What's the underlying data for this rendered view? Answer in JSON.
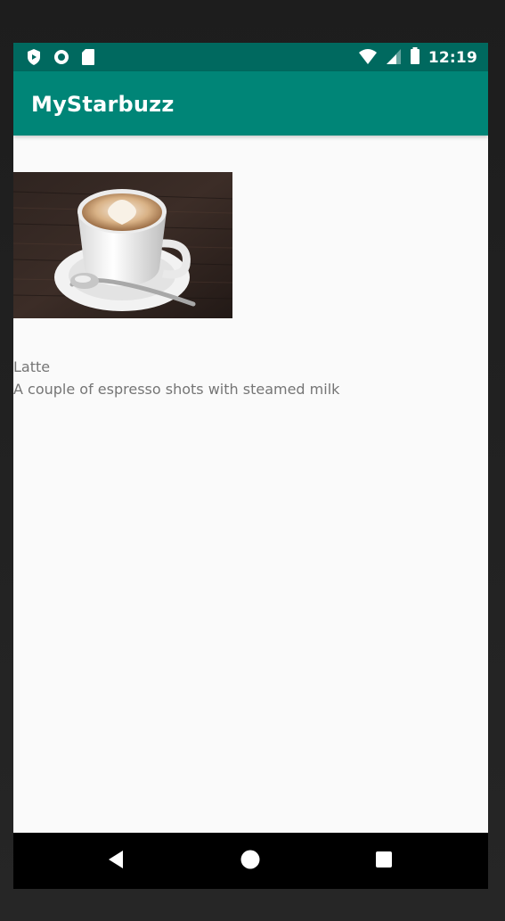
{
  "status_bar": {
    "time": "12:19",
    "left_icons": [
      "shield-icon",
      "circle-status-icon",
      "sd-card-icon"
    ],
    "right_icons": [
      "wifi-icon",
      "signal-icon",
      "battery-icon"
    ]
  },
  "app_bar": {
    "title": "MyStarbuzz",
    "color": "#008577",
    "status_color": "#00695f"
  },
  "drink": {
    "image_icon": "latte-image",
    "name": "Latte",
    "description": "A couple of espresso shots with steamed milk"
  },
  "nav_bar": {
    "buttons": [
      "back-icon",
      "home-icon",
      "recents-icon"
    ]
  }
}
